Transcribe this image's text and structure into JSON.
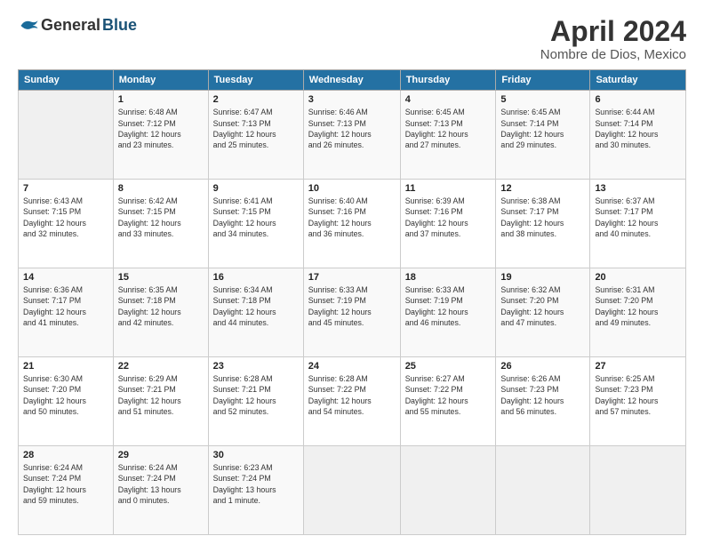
{
  "header": {
    "logo_general": "General",
    "logo_blue": "Blue",
    "title": "April 2024",
    "subtitle": "Nombre de Dios, Mexico"
  },
  "columns": [
    "Sunday",
    "Monday",
    "Tuesday",
    "Wednesday",
    "Thursday",
    "Friday",
    "Saturday"
  ],
  "weeks": [
    [
      {
        "day": "",
        "info": ""
      },
      {
        "day": "1",
        "info": "Sunrise: 6:48 AM\nSunset: 7:12 PM\nDaylight: 12 hours\nand 23 minutes."
      },
      {
        "day": "2",
        "info": "Sunrise: 6:47 AM\nSunset: 7:13 PM\nDaylight: 12 hours\nand 25 minutes."
      },
      {
        "day": "3",
        "info": "Sunrise: 6:46 AM\nSunset: 7:13 PM\nDaylight: 12 hours\nand 26 minutes."
      },
      {
        "day": "4",
        "info": "Sunrise: 6:45 AM\nSunset: 7:13 PM\nDaylight: 12 hours\nand 27 minutes."
      },
      {
        "day": "5",
        "info": "Sunrise: 6:45 AM\nSunset: 7:14 PM\nDaylight: 12 hours\nand 29 minutes."
      },
      {
        "day": "6",
        "info": "Sunrise: 6:44 AM\nSunset: 7:14 PM\nDaylight: 12 hours\nand 30 minutes."
      }
    ],
    [
      {
        "day": "7",
        "info": "Sunrise: 6:43 AM\nSunset: 7:15 PM\nDaylight: 12 hours\nand 32 minutes."
      },
      {
        "day": "8",
        "info": "Sunrise: 6:42 AM\nSunset: 7:15 PM\nDaylight: 12 hours\nand 33 minutes."
      },
      {
        "day": "9",
        "info": "Sunrise: 6:41 AM\nSunset: 7:15 PM\nDaylight: 12 hours\nand 34 minutes."
      },
      {
        "day": "10",
        "info": "Sunrise: 6:40 AM\nSunset: 7:16 PM\nDaylight: 12 hours\nand 36 minutes."
      },
      {
        "day": "11",
        "info": "Sunrise: 6:39 AM\nSunset: 7:16 PM\nDaylight: 12 hours\nand 37 minutes."
      },
      {
        "day": "12",
        "info": "Sunrise: 6:38 AM\nSunset: 7:17 PM\nDaylight: 12 hours\nand 38 minutes."
      },
      {
        "day": "13",
        "info": "Sunrise: 6:37 AM\nSunset: 7:17 PM\nDaylight: 12 hours\nand 40 minutes."
      }
    ],
    [
      {
        "day": "14",
        "info": "Sunrise: 6:36 AM\nSunset: 7:17 PM\nDaylight: 12 hours\nand 41 minutes."
      },
      {
        "day": "15",
        "info": "Sunrise: 6:35 AM\nSunset: 7:18 PM\nDaylight: 12 hours\nand 42 minutes."
      },
      {
        "day": "16",
        "info": "Sunrise: 6:34 AM\nSunset: 7:18 PM\nDaylight: 12 hours\nand 44 minutes."
      },
      {
        "day": "17",
        "info": "Sunrise: 6:33 AM\nSunset: 7:19 PM\nDaylight: 12 hours\nand 45 minutes."
      },
      {
        "day": "18",
        "info": "Sunrise: 6:33 AM\nSunset: 7:19 PM\nDaylight: 12 hours\nand 46 minutes."
      },
      {
        "day": "19",
        "info": "Sunrise: 6:32 AM\nSunset: 7:20 PM\nDaylight: 12 hours\nand 47 minutes."
      },
      {
        "day": "20",
        "info": "Sunrise: 6:31 AM\nSunset: 7:20 PM\nDaylight: 12 hours\nand 49 minutes."
      }
    ],
    [
      {
        "day": "21",
        "info": "Sunrise: 6:30 AM\nSunset: 7:20 PM\nDaylight: 12 hours\nand 50 minutes."
      },
      {
        "day": "22",
        "info": "Sunrise: 6:29 AM\nSunset: 7:21 PM\nDaylight: 12 hours\nand 51 minutes."
      },
      {
        "day": "23",
        "info": "Sunrise: 6:28 AM\nSunset: 7:21 PM\nDaylight: 12 hours\nand 52 minutes."
      },
      {
        "day": "24",
        "info": "Sunrise: 6:28 AM\nSunset: 7:22 PM\nDaylight: 12 hours\nand 54 minutes."
      },
      {
        "day": "25",
        "info": "Sunrise: 6:27 AM\nSunset: 7:22 PM\nDaylight: 12 hours\nand 55 minutes."
      },
      {
        "day": "26",
        "info": "Sunrise: 6:26 AM\nSunset: 7:23 PM\nDaylight: 12 hours\nand 56 minutes."
      },
      {
        "day": "27",
        "info": "Sunrise: 6:25 AM\nSunset: 7:23 PM\nDaylight: 12 hours\nand 57 minutes."
      }
    ],
    [
      {
        "day": "28",
        "info": "Sunrise: 6:24 AM\nSunset: 7:24 PM\nDaylight: 12 hours\nand 59 minutes."
      },
      {
        "day": "29",
        "info": "Sunrise: 6:24 AM\nSunset: 7:24 PM\nDaylight: 13 hours\nand 0 minutes."
      },
      {
        "day": "30",
        "info": "Sunrise: 6:23 AM\nSunset: 7:24 PM\nDaylight: 13 hours\nand 1 minute."
      },
      {
        "day": "",
        "info": ""
      },
      {
        "day": "",
        "info": ""
      },
      {
        "day": "",
        "info": ""
      },
      {
        "day": "",
        "info": ""
      }
    ]
  ]
}
